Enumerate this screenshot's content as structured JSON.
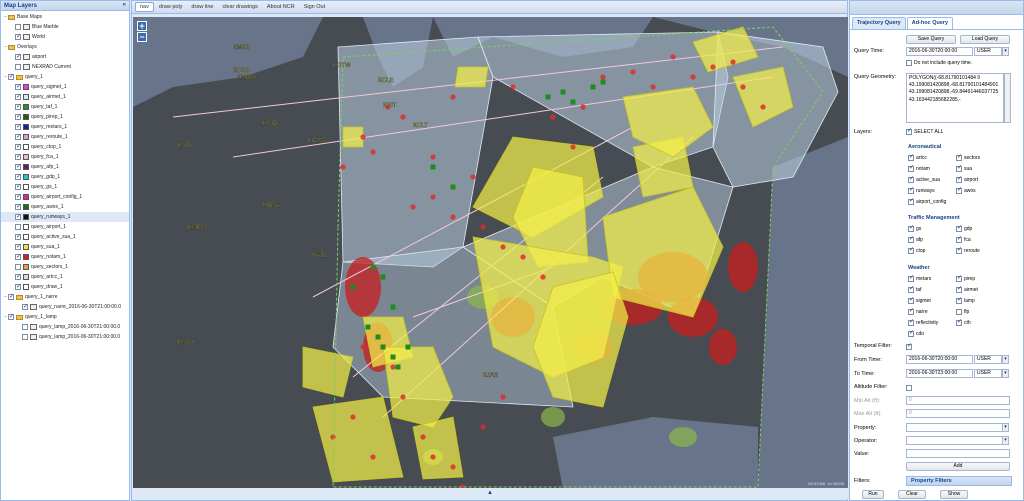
{
  "left_panel": {
    "title": "Map Layers",
    "collapse_glyph": "«",
    "tree": [
      {
        "label": "Base Maps",
        "kind": "folder",
        "expand": "−",
        "indent": 0
      },
      {
        "label": "Blue Marble",
        "kind": "layer",
        "checked": false,
        "indent": 1
      },
      {
        "label": "World",
        "kind": "layer",
        "checked": true,
        "indent": 1
      },
      {
        "label": "Overlays",
        "kind": "folder",
        "expand": "−",
        "indent": 0
      },
      {
        "label": "airport",
        "kind": "layer",
        "checked": true,
        "indent": 1
      },
      {
        "label": "NEXRAD Current",
        "kind": "layer",
        "checked": false,
        "indent": 1
      },
      {
        "label": "query_1",
        "kind": "folder",
        "expand": "−",
        "indent": 0,
        "checked": true
      },
      {
        "label": "query_sigmet_1",
        "kind": "swatch",
        "color": "#e040e0",
        "checked": true,
        "indent": 1
      },
      {
        "label": "query_airmet_1",
        "kind": "swatch",
        "color": "#d7e8f8",
        "checked": true,
        "indent": 1
      },
      {
        "label": "query_taf_1",
        "kind": "swatch",
        "color": "#2e8b2e",
        "checked": true,
        "indent": 1
      },
      {
        "label": "query_pirep_1",
        "kind": "swatch",
        "color": "#1d5c1d",
        "checked": true,
        "indent": 1
      },
      {
        "label": "query_metars_1",
        "kind": "swatch",
        "color": "#1a1aa8",
        "checked": true,
        "indent": 1
      },
      {
        "label": "query_reroute_1",
        "kind": "swatch",
        "color": "#e0a0c0",
        "checked": true,
        "indent": 1
      },
      {
        "label": "query_ctop_1",
        "kind": "swatch",
        "color": "#ffffff",
        "checked": true,
        "indent": 1
      },
      {
        "label": "query_fca_1",
        "kind": "swatch",
        "color": "#f0b8d8",
        "checked": true,
        "indent": 1
      },
      {
        "label": "query_afp_1",
        "kind": "swatch",
        "color": "#6a1a6a",
        "checked": true,
        "indent": 1
      },
      {
        "label": "query_gdp_1",
        "kind": "swatch",
        "color": "#20c8c8",
        "checked": true,
        "indent": 1
      },
      {
        "label": "query_gs_1",
        "kind": "swatch",
        "color": "#ffffff",
        "checked": true,
        "indent": 1
      },
      {
        "label": "query_airport_config_1",
        "kind": "swatch",
        "color": "#e020a0",
        "checked": true,
        "indent": 1
      },
      {
        "label": "query_awos_1",
        "kind": "swatch",
        "color": "#1d6a1d",
        "checked": true,
        "indent": 1
      },
      {
        "label": "query_runways_1",
        "kind": "swatch",
        "color": "#111111",
        "checked": true,
        "indent": 1,
        "selected": true
      },
      {
        "label": "query_airport_1",
        "kind": "swatch",
        "color": "#ffffff",
        "checked": false,
        "indent": 1
      },
      {
        "label": "query_active_sua_1",
        "kind": "swatch",
        "color": "#ffffff",
        "checked": true,
        "indent": 1
      },
      {
        "label": "query_sua_1",
        "kind": "swatch",
        "color": "#f0e040",
        "checked": true,
        "indent": 1
      },
      {
        "label": "query_notam_1",
        "kind": "swatch",
        "color": "#d02020",
        "checked": true,
        "indent": 1
      },
      {
        "label": "query_sectors_1",
        "kind": "swatch",
        "color": "#e8a040",
        "checked": false,
        "indent": 1
      },
      {
        "label": "query_artcc_1",
        "kind": "swatch",
        "color": "#c8e0f0",
        "checked": true,
        "indent": 1
      },
      {
        "label": "query_draw_1",
        "kind": "swatch",
        "color": "#ffffff",
        "checked": true,
        "indent": 1
      },
      {
        "label": "query_1_narre",
        "kind": "folder",
        "expand": "−",
        "indent": 0,
        "checked": true
      },
      {
        "label": "query_narre_2016-06-30T21:00:00.0",
        "kind": "layer",
        "checked": true,
        "indent": 2
      },
      {
        "label": "query_1_lamp",
        "kind": "folder",
        "expand": "−",
        "indent": 0,
        "checked": true
      },
      {
        "label": "query_lamp_2016-06-30T21:00:00.0",
        "kind": "layer",
        "checked": false,
        "indent": 2
      },
      {
        "label": "query_lamp_2016-06-30T21:00:00.0",
        "kind": "layer",
        "checked": false,
        "indent": 2
      }
    ]
  },
  "toolbar": {
    "buttons": [
      "nav",
      "draw poly",
      "draw line",
      "clear drawings",
      "About NCR",
      "Sign Out"
    ],
    "active": "nav"
  },
  "map": {
    "zoom_in": "+",
    "zoom_out": "−",
    "coords": "-89.51966, 44.35098",
    "splitter_glyph": "▲",
    "labels": [
      "KMKE",
      "KORD",
      "KMDW",
      "KDTW",
      "KSTL",
      "KIND",
      "KBNA",
      "KMEM",
      "KCLE",
      "KPIT",
      "KCVG",
      "KATL",
      "KCLT",
      "KMSY",
      "KJAX"
    ],
    "colors": {
      "land": "#4a4e55",
      "water": "#68748a",
      "artcc_fill": "#b9cfe0",
      "sua_fill": "#f2ee4a",
      "notam": "#e02c2c",
      "weather": "#c81e1e",
      "taf": "#1e8c1e",
      "route": "#f0c8dc"
    }
  },
  "right_panel": {
    "tabs": [
      "Trajectory Query",
      "Ad-hoc Query"
    ],
    "active_tab": "Ad-hoc Query",
    "save_query": "Save Query",
    "load_query": "Load Query",
    "query_time_label": "Query Time:",
    "query_time_value": "2016-06-30T20:00:00",
    "query_time_unit": "USER",
    "dont_include": "Do not include query time.",
    "geometry_label": "Query Geometry:",
    "geometry_value": "POLYGON((-68.81790101484 9 43.199081420898,-68.81790101484901 43.199081420898,-69.84491446037725 43.163442185682285,-",
    "layers_label": "Layers:",
    "select_all": "SELECT ALL",
    "groups": [
      {
        "title": "Aeronautical",
        "items": [
          "artcc",
          "sectors",
          "notam",
          "sua",
          "active_sua",
          "airport",
          "runways",
          "awos",
          "airport_config"
        ]
      },
      {
        "title": "Traffic Management",
        "items": [
          "gs",
          "gdp",
          "afp",
          "fca",
          "ctop",
          "reroute"
        ]
      },
      {
        "title": "Weather",
        "items": [
          "metars",
          "pirep",
          "taf",
          "airmet",
          "sigmet",
          "lamp",
          "narre",
          "flp",
          "reflectivity",
          "cth",
          "cdo"
        ]
      }
    ],
    "unchecked_items": [
      "flp"
    ],
    "temporal_filter_label": "Temporal Filter:",
    "from_time_label": "From Time:",
    "from_time_value": "2016-06-30T20:00:00",
    "to_time_label": "To Time:",
    "to_time_value": "2016-06-30T23:00:00",
    "time_unit": "USER",
    "altitude_filter_label": "Altitude Filter:",
    "min_alt_label": "Min Alt (ft):",
    "max_alt_label": "Max Alt (ft):",
    "min_alt_value": "0",
    "max_alt_value": "0",
    "property_label": "Property:",
    "operator_label": "Operator:",
    "value_label": "Value:",
    "add_button": "Add",
    "filters_label": "Filters:",
    "property_filters": "Property Filters",
    "run_button": "Run",
    "clear_button": "Clear",
    "show_button": "Show",
    "dropdown_glyph": "▾"
  }
}
